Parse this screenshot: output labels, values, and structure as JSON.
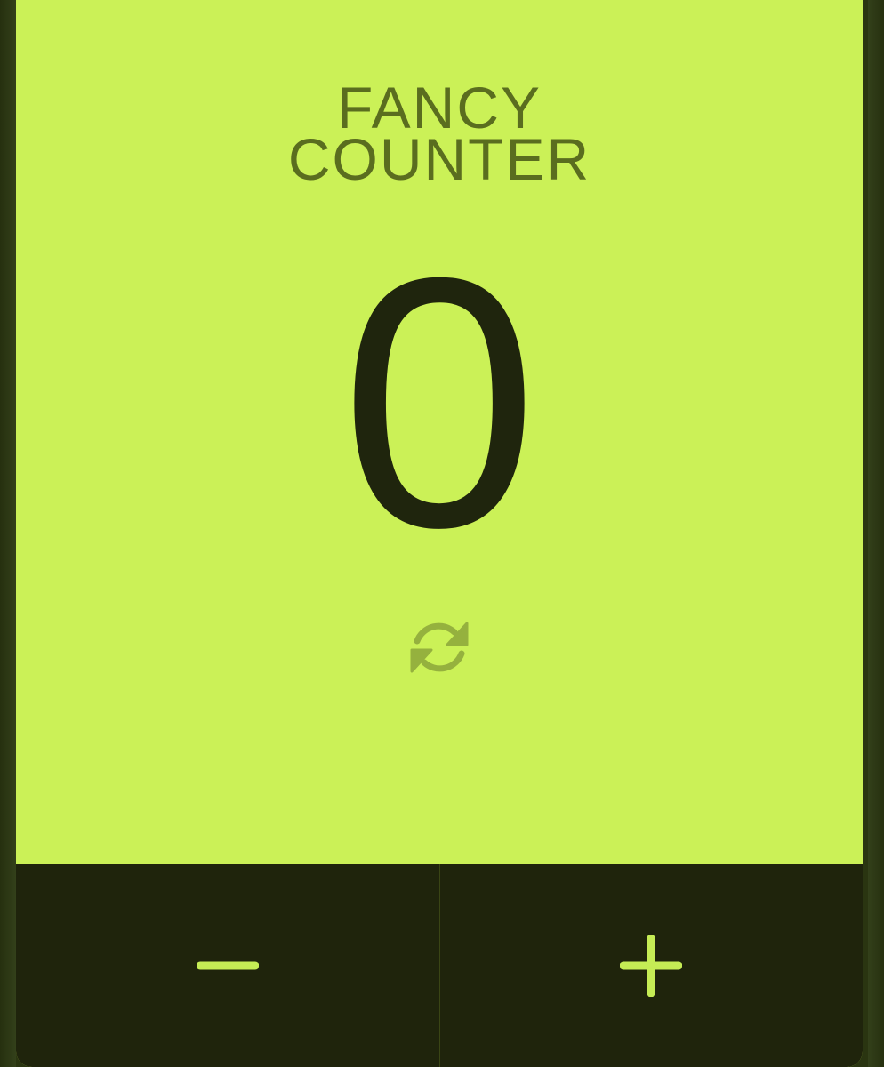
{
  "app": {
    "title_line1": "FANCY",
    "title_line2": "COUNTER"
  },
  "counter": {
    "value": "0"
  },
  "icons": {
    "reset": "refresh-icon",
    "decrement": "minus-icon",
    "increment": "plus-icon"
  },
  "colors": {
    "background": "#cbf157",
    "title": "#5a6d1f",
    "count": "#1f250d",
    "controls_bg": "#1f240c",
    "accent": "#c5ec55",
    "reset_icon": "#95b13e"
  }
}
